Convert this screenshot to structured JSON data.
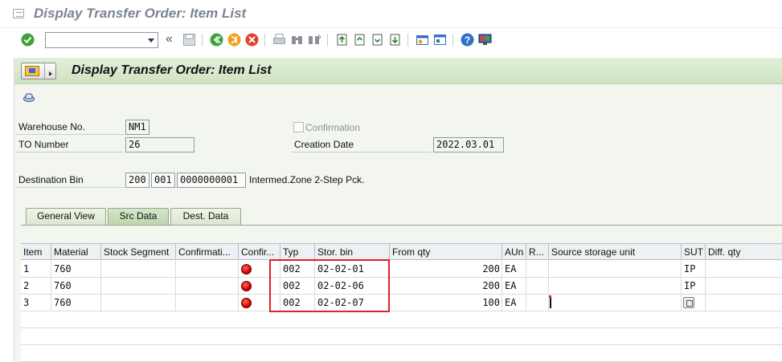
{
  "window": {
    "title": "Display Transfer Order: Item List"
  },
  "system_toolbar": {
    "okcode_value": "",
    "icons": [
      "enter-icon",
      "back-double-chevron-icon",
      "save-icon",
      "back-icon",
      "exit-icon",
      "cancel-icon",
      "print-icon",
      "find-icon",
      "find-next-icon",
      "first-page-icon",
      "previous-page-icon",
      "next-page-icon",
      "last-page-icon",
      "create-session-icon",
      "shortcut-icon",
      "help-icon",
      "layout-menu-icon"
    ]
  },
  "app": {
    "title": "Display Transfer Order: Item List",
    "toolbar_icons": [
      "display-header-icon"
    ]
  },
  "form": {
    "warehouse_label": "Warehouse No.",
    "warehouse_value": "NM1",
    "to_number_label": "TO Number",
    "to_number_value": "26",
    "confirmation_label": "Confirmation",
    "confirmation_checked": false,
    "creation_date_label": "Creation Date",
    "creation_date_value": "2022.03.01",
    "dest_bin_label": "Destination Bin",
    "dest_bin_type": "200",
    "dest_bin_section": "001",
    "dest_bin_number": "0000000001",
    "dest_bin_desc": "Intermed.Zone 2-Step Pck."
  },
  "tabs": [
    {
      "label": "General View",
      "active": false
    },
    {
      "label": "Src Data",
      "active": true
    },
    {
      "label": "Dest. Data",
      "active": false
    }
  ],
  "table": {
    "columns": [
      "Item",
      "Material",
      "Stock Segment",
      "Confirmati...",
      "Confir...",
      "Typ",
      "Stor. bin",
      "From qty",
      "AUn",
      "R...",
      "Source storage unit",
      "SUT",
      "Diff. qty"
    ],
    "rows": [
      {
        "item": "1",
        "material": "760",
        "stock_segment": "",
        "confirmation": "",
        "status": "red-light-icon",
        "typ": "002",
        "stor_bin": "02-02-01",
        "from_qty": "200",
        "aun": "EA",
        "r": "",
        "source_su": "",
        "sut": "IP",
        "diff_qty": ""
      },
      {
        "item": "2",
        "material": "760",
        "stock_segment": "",
        "confirmation": "",
        "status": "red-light-icon",
        "typ": "002",
        "stor_bin": "02-02-06",
        "from_qty": "200",
        "aun": "EA",
        "r": "",
        "source_su": "",
        "sut": "IP",
        "diff_qty": ""
      },
      {
        "item": "3",
        "material": "760",
        "stock_segment": "",
        "confirmation": "",
        "status": "red-light-icon",
        "typ": "002",
        "stor_bin": "02-02-07",
        "from_qty": "100",
        "aun": "EA",
        "r": "",
        "source_su": "",
        "sut": "",
        "diff_qty": ""
      }
    ]
  },
  "colors": {
    "frame_bg": "#f2f6ef",
    "title_green": "#cfe3c2",
    "highlight_red": "#e0202a",
    "status_red": "#d40000"
  }
}
